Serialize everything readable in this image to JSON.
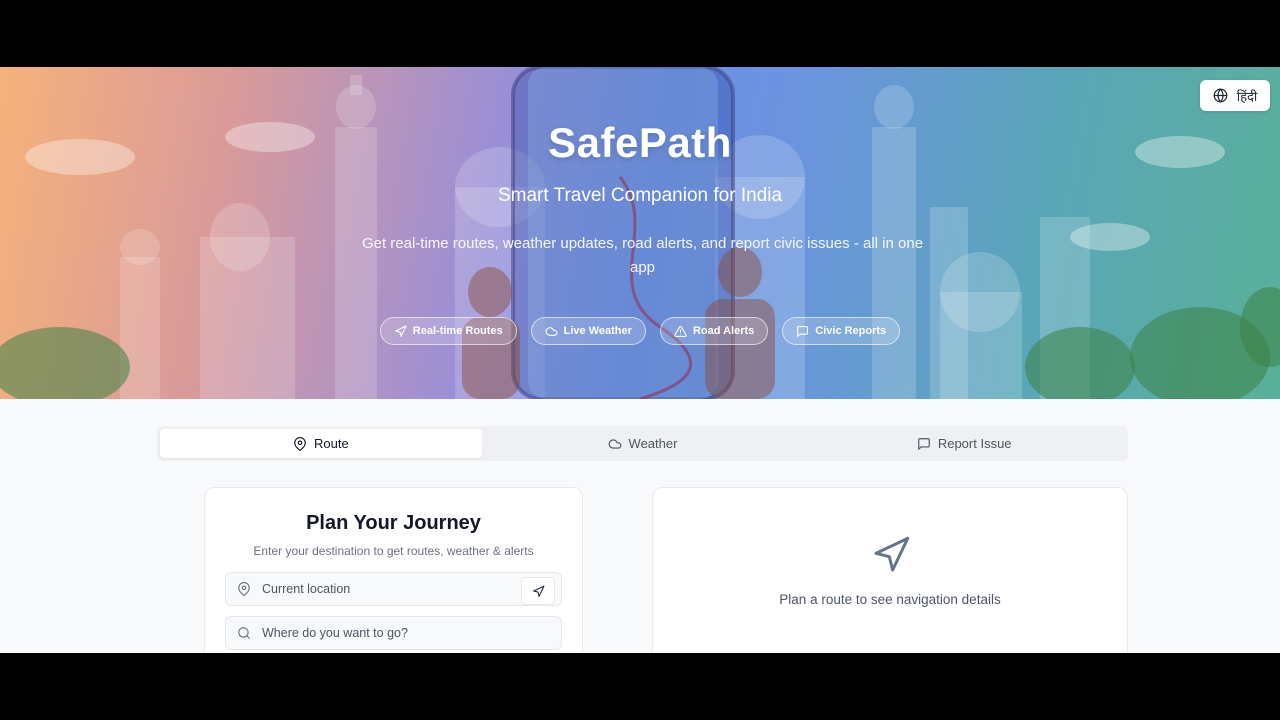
{
  "language_button": {
    "label": "हिंदी",
    "icon": "globe-icon"
  },
  "hero": {
    "title": "SafePath",
    "subtitle": "Smart Travel Companion for India",
    "description": "Get real-time routes, weather updates, road alerts, and report civic issues - all in one app",
    "features": [
      {
        "label": "Real-time Routes",
        "icon": "navigation-icon"
      },
      {
        "label": "Live Weather",
        "icon": "cloud-icon"
      },
      {
        "label": "Road Alerts",
        "icon": "alert-triangle-icon"
      },
      {
        "label": "Civic Reports",
        "icon": "message-square-icon"
      }
    ]
  },
  "tabs": [
    {
      "label": "Route",
      "icon": "map-pin-icon",
      "active": true
    },
    {
      "label": "Weather",
      "icon": "cloud-icon",
      "active": false
    },
    {
      "label": "Report Issue",
      "icon": "message-square-icon",
      "active": false
    }
  ],
  "planner": {
    "title": "Plan Your Journey",
    "subtitle": "Enter your destination to get routes, weather & alerts",
    "origin_placeholder": "Current location",
    "destination_placeholder": "Where do you want to go?"
  },
  "navigation_panel": {
    "empty_text": "Plan a route to see navigation details"
  },
  "colors": {
    "accent": "#111827",
    "hero_gradient": [
      "#f6b27a",
      "#9b8fd6",
      "#6e8de6",
      "#59b098"
    ]
  }
}
